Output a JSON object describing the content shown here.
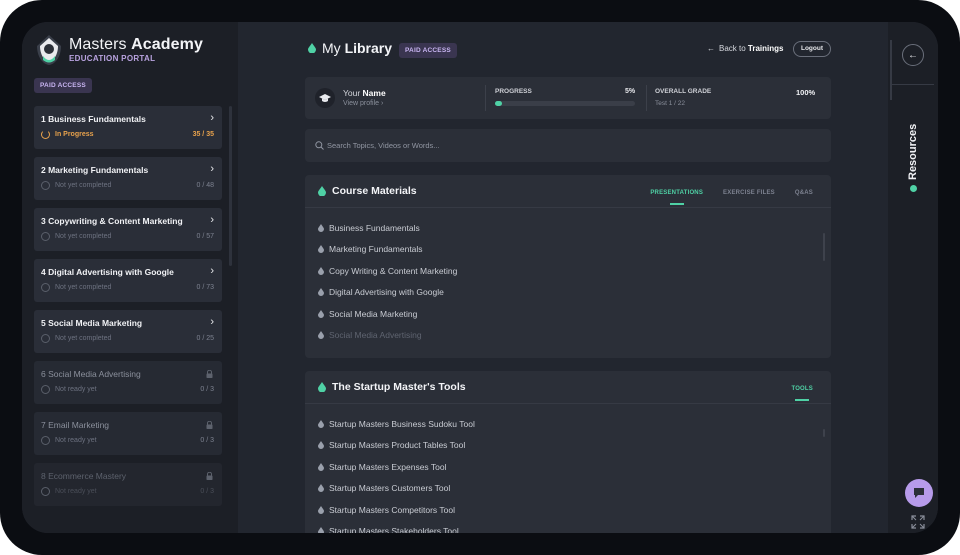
{
  "brand": {
    "title_regular": "Masters ",
    "title_bold": "Academy",
    "subtitle": "EDUCATION PORTAL",
    "badge": "PAID ACCESS"
  },
  "courses": [
    {
      "title": "1 Business Fundamentals",
      "status": "In Progress",
      "count": "35 / 35",
      "state": "active",
      "action": "chevron"
    },
    {
      "title": "2 Marketing Fundamentals",
      "status": "Not yet completed",
      "count": "0 / 48",
      "state": "open",
      "action": "chevron"
    },
    {
      "title": "3 Copywriting & Content Marketing",
      "status": "Not yet completed",
      "count": "0 / 57",
      "state": "open",
      "action": "chevron"
    },
    {
      "title": "4 Digital Advertising with Google",
      "status": "Not yet completed",
      "count": "0 / 73",
      "state": "open",
      "action": "chevron"
    },
    {
      "title": "5 Social Media Marketing",
      "status": "Not yet completed",
      "count": "0 / 25",
      "state": "open",
      "action": "chevron"
    },
    {
      "title": "6 Social Media Advertising",
      "status": "Not ready yet",
      "count": "0 / 3",
      "state": "locked",
      "action": "lock"
    },
    {
      "title": "7 Email Marketing",
      "status": "Not ready yet",
      "count": "0 / 3",
      "state": "locked",
      "action": "lock"
    },
    {
      "title": "8 Ecommerce Mastery",
      "status": "Not ready yet",
      "count": "0 / 3",
      "state": "faded",
      "action": "lock"
    }
  ],
  "header": {
    "title_regular": "My ",
    "title_bold": "Library",
    "badge": "PAID ACCESS",
    "back_prefix": "Back to ",
    "back_bold": "Trainings",
    "logout": "Logout"
  },
  "profile": {
    "greeting": "Your ",
    "name": "Name",
    "view_profile": "View profile",
    "progress_label": "PROGRESS",
    "progress_value": "5%",
    "progress_fraction": 0.05,
    "grade_label": "OVERALL GRADE",
    "grade_sub": "Test 1 / 22",
    "grade_value": "100%"
  },
  "search": {
    "placeholder": "Search Topics, Videos or Words..."
  },
  "materials": {
    "title": "Course Materials",
    "tabs": [
      "PRESENTATIONS",
      "EXERCISE FILES",
      "Q&AS"
    ],
    "items": [
      "Business Fundamentals",
      "Marketing Fundamentals",
      "Copy Writing & Content Marketing",
      "Digital Advertising with Google",
      "Social Media Marketing",
      "Social Media Advertising"
    ]
  },
  "tools": {
    "title": "The Startup Master's Tools",
    "tabs": [
      "TOOLS"
    ],
    "items": [
      "Startup Masters Business Sudoku Tool",
      "Startup Masters Product Tables Tool",
      "Startup Masters Expenses Tool",
      "Startup Masters Customers Tool",
      "Startup Masters Competitors Tool",
      "Startup Masters Stakeholders Tool"
    ]
  },
  "rail": {
    "resources_label": "Resources"
  },
  "colors": {
    "accent": "#4fd1a5",
    "purple": "#b79bea",
    "in_progress": "#e8a24c"
  }
}
